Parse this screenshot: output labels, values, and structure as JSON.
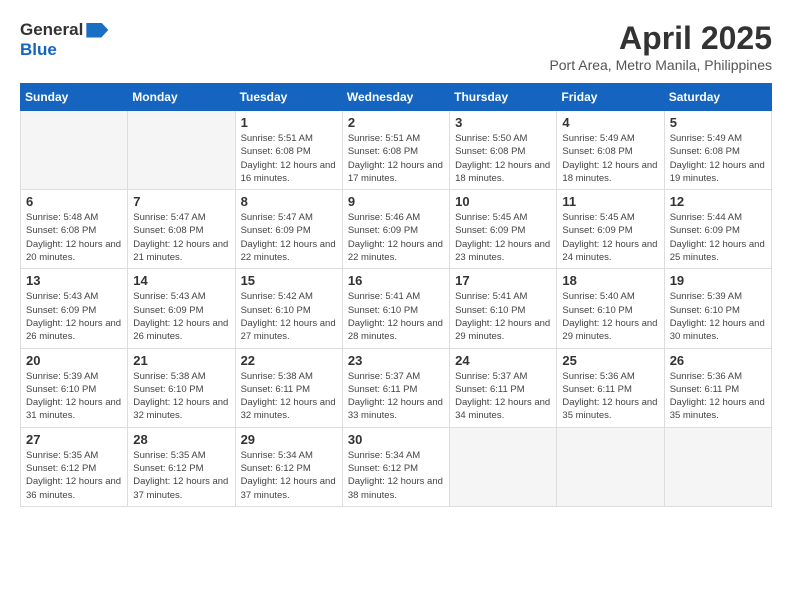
{
  "header": {
    "logo_general": "General",
    "logo_blue": "Blue",
    "month_year": "April 2025",
    "location": "Port Area, Metro Manila, Philippines"
  },
  "days_of_week": [
    "Sunday",
    "Monday",
    "Tuesday",
    "Wednesday",
    "Thursday",
    "Friday",
    "Saturday"
  ],
  "weeks": [
    [
      {
        "day": "",
        "info": ""
      },
      {
        "day": "",
        "info": ""
      },
      {
        "day": "1",
        "info": "Sunrise: 5:51 AM\nSunset: 6:08 PM\nDaylight: 12 hours and 16 minutes."
      },
      {
        "day": "2",
        "info": "Sunrise: 5:51 AM\nSunset: 6:08 PM\nDaylight: 12 hours and 17 minutes."
      },
      {
        "day": "3",
        "info": "Sunrise: 5:50 AM\nSunset: 6:08 PM\nDaylight: 12 hours and 18 minutes."
      },
      {
        "day": "4",
        "info": "Sunrise: 5:49 AM\nSunset: 6:08 PM\nDaylight: 12 hours and 18 minutes."
      },
      {
        "day": "5",
        "info": "Sunrise: 5:49 AM\nSunset: 6:08 PM\nDaylight: 12 hours and 19 minutes."
      }
    ],
    [
      {
        "day": "6",
        "info": "Sunrise: 5:48 AM\nSunset: 6:08 PM\nDaylight: 12 hours and 20 minutes."
      },
      {
        "day": "7",
        "info": "Sunrise: 5:47 AM\nSunset: 6:08 PM\nDaylight: 12 hours and 21 minutes."
      },
      {
        "day": "8",
        "info": "Sunrise: 5:47 AM\nSunset: 6:09 PM\nDaylight: 12 hours and 22 minutes."
      },
      {
        "day": "9",
        "info": "Sunrise: 5:46 AM\nSunset: 6:09 PM\nDaylight: 12 hours and 22 minutes."
      },
      {
        "day": "10",
        "info": "Sunrise: 5:45 AM\nSunset: 6:09 PM\nDaylight: 12 hours and 23 minutes."
      },
      {
        "day": "11",
        "info": "Sunrise: 5:45 AM\nSunset: 6:09 PM\nDaylight: 12 hours and 24 minutes."
      },
      {
        "day": "12",
        "info": "Sunrise: 5:44 AM\nSunset: 6:09 PM\nDaylight: 12 hours and 25 minutes."
      }
    ],
    [
      {
        "day": "13",
        "info": "Sunrise: 5:43 AM\nSunset: 6:09 PM\nDaylight: 12 hours and 26 minutes."
      },
      {
        "day": "14",
        "info": "Sunrise: 5:43 AM\nSunset: 6:09 PM\nDaylight: 12 hours and 26 minutes."
      },
      {
        "day": "15",
        "info": "Sunrise: 5:42 AM\nSunset: 6:10 PM\nDaylight: 12 hours and 27 minutes."
      },
      {
        "day": "16",
        "info": "Sunrise: 5:41 AM\nSunset: 6:10 PM\nDaylight: 12 hours and 28 minutes."
      },
      {
        "day": "17",
        "info": "Sunrise: 5:41 AM\nSunset: 6:10 PM\nDaylight: 12 hours and 29 minutes."
      },
      {
        "day": "18",
        "info": "Sunrise: 5:40 AM\nSunset: 6:10 PM\nDaylight: 12 hours and 29 minutes."
      },
      {
        "day": "19",
        "info": "Sunrise: 5:39 AM\nSunset: 6:10 PM\nDaylight: 12 hours and 30 minutes."
      }
    ],
    [
      {
        "day": "20",
        "info": "Sunrise: 5:39 AM\nSunset: 6:10 PM\nDaylight: 12 hours and 31 minutes."
      },
      {
        "day": "21",
        "info": "Sunrise: 5:38 AM\nSunset: 6:10 PM\nDaylight: 12 hours and 32 minutes."
      },
      {
        "day": "22",
        "info": "Sunrise: 5:38 AM\nSunset: 6:11 PM\nDaylight: 12 hours and 32 minutes."
      },
      {
        "day": "23",
        "info": "Sunrise: 5:37 AM\nSunset: 6:11 PM\nDaylight: 12 hours and 33 minutes."
      },
      {
        "day": "24",
        "info": "Sunrise: 5:37 AM\nSunset: 6:11 PM\nDaylight: 12 hours and 34 minutes."
      },
      {
        "day": "25",
        "info": "Sunrise: 5:36 AM\nSunset: 6:11 PM\nDaylight: 12 hours and 35 minutes."
      },
      {
        "day": "26",
        "info": "Sunrise: 5:36 AM\nSunset: 6:11 PM\nDaylight: 12 hours and 35 minutes."
      }
    ],
    [
      {
        "day": "27",
        "info": "Sunrise: 5:35 AM\nSunset: 6:12 PM\nDaylight: 12 hours and 36 minutes."
      },
      {
        "day": "28",
        "info": "Sunrise: 5:35 AM\nSunset: 6:12 PM\nDaylight: 12 hours and 37 minutes."
      },
      {
        "day": "29",
        "info": "Sunrise: 5:34 AM\nSunset: 6:12 PM\nDaylight: 12 hours and 37 minutes."
      },
      {
        "day": "30",
        "info": "Sunrise: 5:34 AM\nSunset: 6:12 PM\nDaylight: 12 hours and 38 minutes."
      },
      {
        "day": "",
        "info": ""
      },
      {
        "day": "",
        "info": ""
      },
      {
        "day": "",
        "info": ""
      }
    ]
  ]
}
